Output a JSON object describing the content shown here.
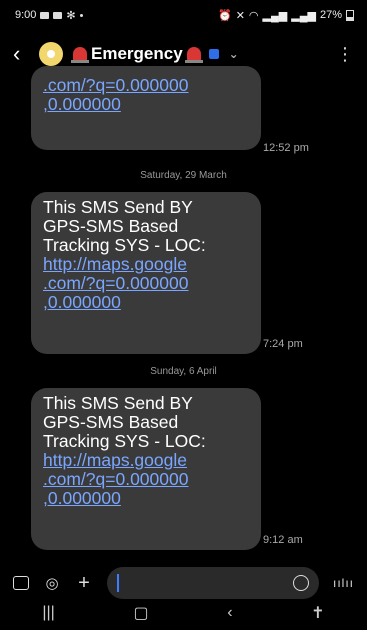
{
  "status_bar": {
    "time": "9:00",
    "battery": "27%"
  },
  "header": {
    "contact_name": "Emergency"
  },
  "messages": [
    {
      "partial": true,
      "text_link": ".com/?q=0.000000\n,0.000000",
      "time": "12:52 pm"
    },
    {
      "date_divider": "Saturday, 29 March",
      "text": "This SMS Send BY\nGPS-SMS Based\nTracking SYS - LOC:",
      "link": "http://maps.google\n.com/?q=0.000000\n,0.000000",
      "time": "7:24 pm"
    },
    {
      "date_divider": "Sunday, 6 April",
      "text": "This SMS Send BY\nGPS-SMS Based\nTracking SYS - LOC:",
      "link": "http://maps.google\n.com/?q=0.000000\n,0.000000",
      "time": "9:12 am"
    }
  ],
  "colors": {
    "bubble": "#3a3a3a",
    "link": "#7aa6ff",
    "background": "#000000",
    "accent": "#3d7bff"
  }
}
